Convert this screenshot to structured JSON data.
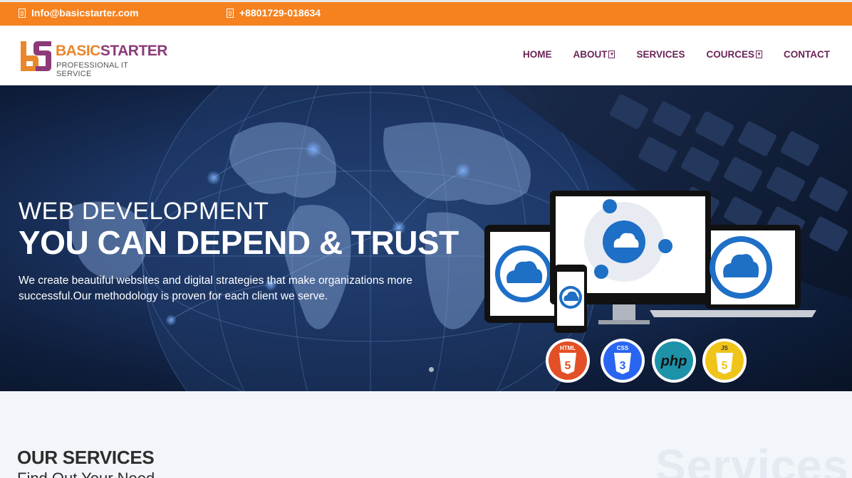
{
  "topbar": {
    "email": "Info@basicstarter.com",
    "phone": "+8801729-018634",
    "bg_color": "#f5821f"
  },
  "logo": {
    "brand_part1": "BASIC",
    "brand_part2": "STARTER",
    "tagline": "PROFESSIONAL IT SERVICE"
  },
  "nav": {
    "items": [
      {
        "label": "HOME"
      },
      {
        "label": "ABOUT"
      },
      {
        "label": "SERVICES"
      },
      {
        "label": "COURCES"
      },
      {
        "label": "CONTACT"
      }
    ],
    "color": "#6a2557"
  },
  "hero": {
    "subtitle": "WEB DEVELOPMENT",
    "title": "YOU CAN DEPEND & TRUST",
    "description": "We create beautiful websites and digital strategies that make organizations more successful.Our methodology is proven for each client we serve.",
    "badges": [
      "HTML",
      "CSS",
      "php",
      "JS"
    ]
  },
  "services": {
    "title": "OUR SERVICES",
    "subtitle": "Find Out Your Need",
    "watermark": "Services"
  }
}
